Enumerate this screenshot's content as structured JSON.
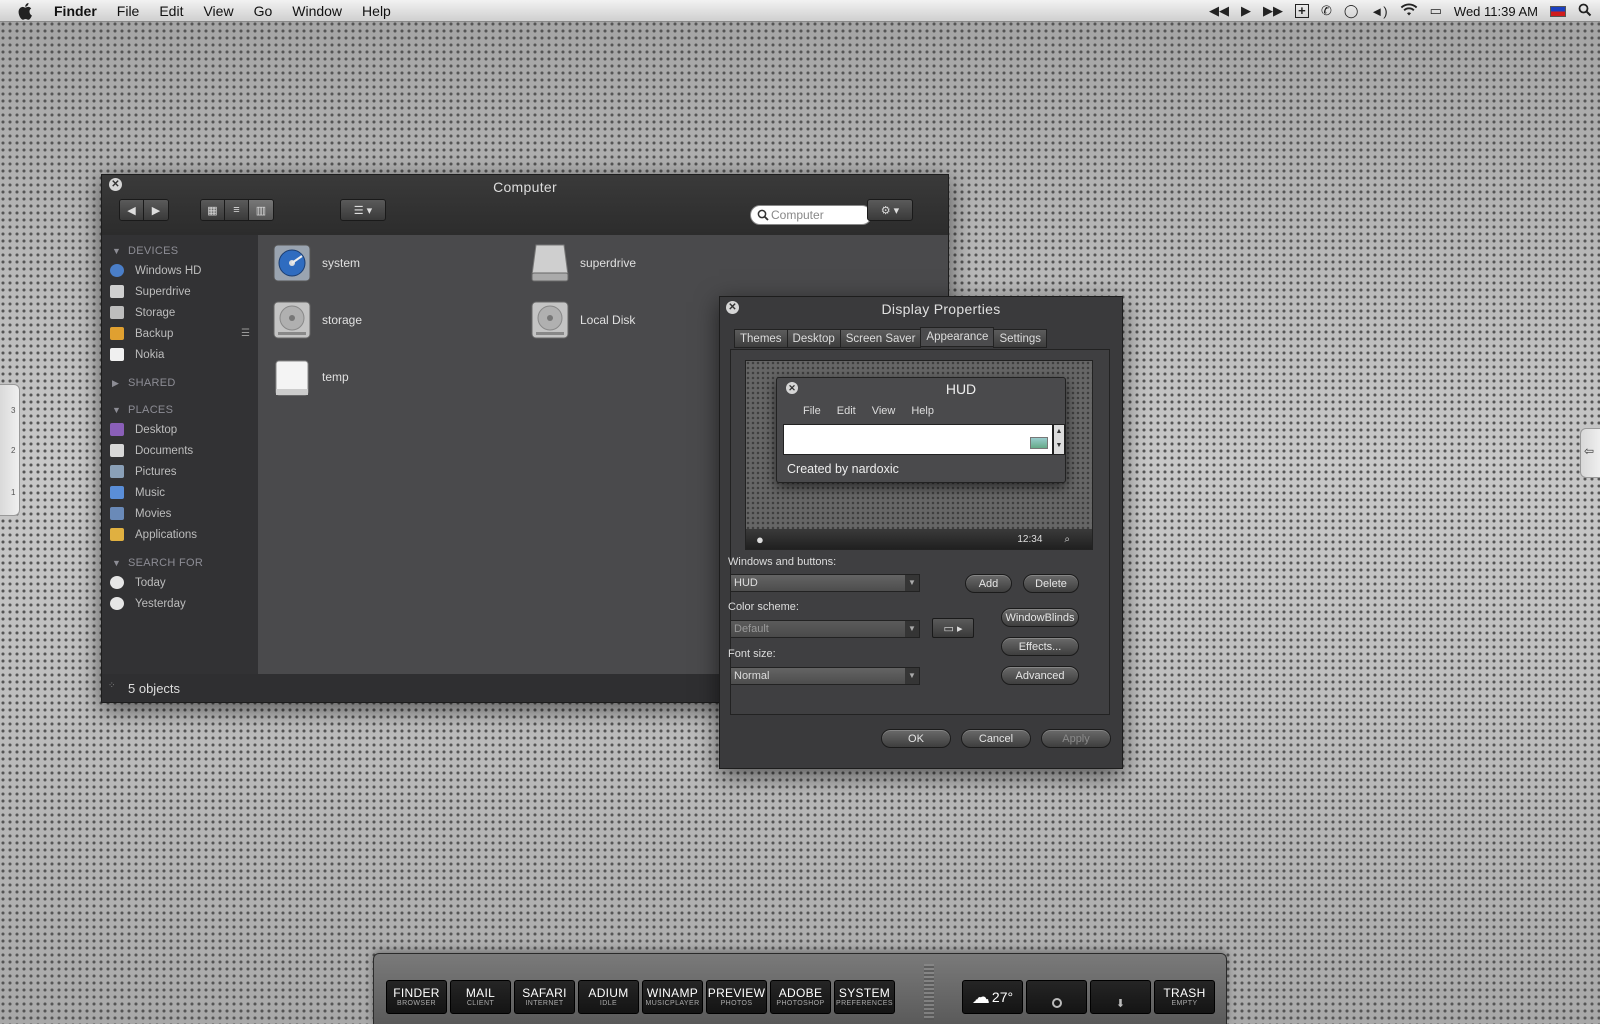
{
  "menubar": {
    "app": "Finder",
    "items": [
      "File",
      "Edit",
      "View",
      "Go",
      "Window",
      "Help"
    ],
    "clock": "Wed 11:39 AM"
  },
  "finder": {
    "title": "Computer",
    "search_placeholder": "Computer",
    "sidebar": {
      "devices_header": "DEVICES",
      "devices": [
        {
          "label": "Windows HD",
          "icon": "hard-disk-icon",
          "color": "#4a7ec8"
        },
        {
          "label": "Superdrive",
          "icon": "drive-icon",
          "color": "#cfcfcf"
        },
        {
          "label": "Storage",
          "icon": "drive-icon",
          "color": "#bdbdbd"
        },
        {
          "label": "Backup",
          "icon": "backup-drive-icon",
          "color": "#e0a030"
        },
        {
          "label": "Nokia",
          "icon": "removable-drive-icon",
          "color": "#f0f0f0"
        }
      ],
      "shared_header": "SHARED",
      "places_header": "PLACES",
      "places": [
        {
          "label": "Desktop",
          "icon": "desktop-icon",
          "color": "#8a5fb8"
        },
        {
          "label": "Documents",
          "icon": "documents-icon",
          "color": "#d8d8d8"
        },
        {
          "label": "Pictures",
          "icon": "pictures-icon",
          "color": "#8aa0b8"
        },
        {
          "label": "Music",
          "icon": "music-icon",
          "color": "#5a8ed8"
        },
        {
          "label": "Movies",
          "icon": "movies-icon",
          "color": "#6a8ab8"
        },
        {
          "label": "Applications",
          "icon": "applications-icon",
          "color": "#e0b040"
        }
      ],
      "search_header": "SEARCH FOR",
      "searches": [
        {
          "label": "Today",
          "icon": "clock-icon"
        },
        {
          "label": "Yesterday",
          "icon": "clock-icon"
        }
      ]
    },
    "files": [
      {
        "label": "system",
        "icon": "hard-disk-icon"
      },
      {
        "label": "superdrive",
        "icon": "drive-icon"
      },
      {
        "label": "storage",
        "icon": "hard-disk-icon"
      },
      {
        "label": "Local Disk",
        "icon": "hard-disk-icon"
      },
      {
        "label": "temp",
        "icon": "removable-drive-icon"
      }
    ],
    "status": "5 objects"
  },
  "display": {
    "title": "Display Properties",
    "tabs": [
      "Themes",
      "Desktop",
      "Screen Saver",
      "Appearance",
      "Settings"
    ],
    "active_tab": "Appearance",
    "preview": {
      "window_title": "HUD",
      "menu": [
        "File",
        "Edit",
        "View",
        "Help"
      ],
      "status": "Created by nardoxic",
      "clock": "12:34"
    },
    "windows_buttons_label": "Windows and buttons:",
    "windows_buttons_value": "HUD",
    "color_scheme_label": "Color scheme:",
    "color_scheme_value": "Default",
    "font_size_label": "Font size:",
    "font_size_value": "Normal",
    "add": "Add",
    "delete": "Delete",
    "windowblinds": "WindowBlinds",
    "effects": "Effects...",
    "advanced": "Advanced",
    "ok": "OK",
    "cancel": "Cancel",
    "apply": "Apply"
  },
  "dock": {
    "left": [
      {
        "title": "FINDER",
        "sub": "BROWSER"
      },
      {
        "title": "MAIL",
        "sub": "CLIENT"
      },
      {
        "title": "SAFARI",
        "sub": "INTERNET"
      },
      {
        "title": "ADIUM",
        "sub": "IDLE"
      },
      {
        "title": "WINAMP",
        "sub": "MUSICPLAYER"
      },
      {
        "title": "PREVIEW",
        "sub": "PHOTOS"
      },
      {
        "title": "ADOBE",
        "sub": "PHOTOSHOP"
      },
      {
        "title": "SYSTEM",
        "sub": "PREFERENCES"
      }
    ],
    "weather_temp": "27°",
    "trash_title": "TRASH",
    "trash_sub": "EMPTY"
  },
  "edge_tabs": [
    "3",
    "2",
    "1"
  ],
  "colors": {
    "window_bg": "#3d3d3f",
    "sidebar_bg": "#323234",
    "content_bg": "#4a4a4c"
  }
}
